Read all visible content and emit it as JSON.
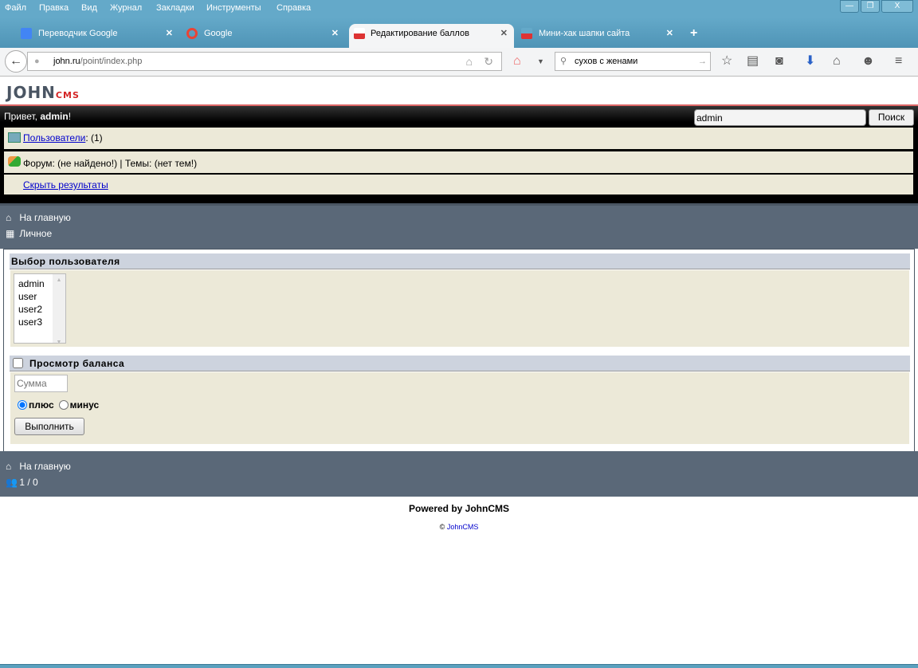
{
  "browser": {
    "menu": [
      "Файл",
      "Правка",
      "Вид",
      "Журнал",
      "Закладки",
      "Инструменты",
      "Справка"
    ],
    "tabs": [
      {
        "title": "Переводчик Google"
      },
      {
        "title": "Google"
      },
      {
        "title": "Редактирование баллов"
      },
      {
        "title": "Мини-хак шапки сайта"
      }
    ],
    "url_host": "john.ru",
    "url_path": "/point/index.php",
    "search_value": "сухов с женами"
  },
  "site": {
    "logo": "JOHN",
    "logo_suffix": "CMS",
    "greeting_prefix": "Привет, ",
    "user": "admin",
    "greeting_suffix": "!",
    "search_value": "admin",
    "search_button": "Поиск",
    "results": {
      "users_link": "Пользователи",
      "users_count": ": (1)",
      "forum": "Форум: (не найдено!) | Темы: (нет тем!)",
      "hide": "Скрыть результаты"
    },
    "nav_top": [
      {
        "label": "На главную"
      },
      {
        "label": "Личное"
      }
    ],
    "form": {
      "select_title": "Выбор пользователя",
      "users": [
        "admin",
        "user",
        "user2",
        "user3"
      ],
      "balance_label": "Просмотр баланса",
      "balance_checked": false,
      "sum_placeholder": "Сумма",
      "radio_plus": "плюс",
      "radio_minus": "минус",
      "selected": "плюс",
      "submit": "Выполнить"
    },
    "nav_bottom": {
      "home": "На главную",
      "online": "1 / 0"
    },
    "powered": "Powered by JohnCMS",
    "copy_symbol": "©",
    "copy_link": "JohnCMS"
  }
}
